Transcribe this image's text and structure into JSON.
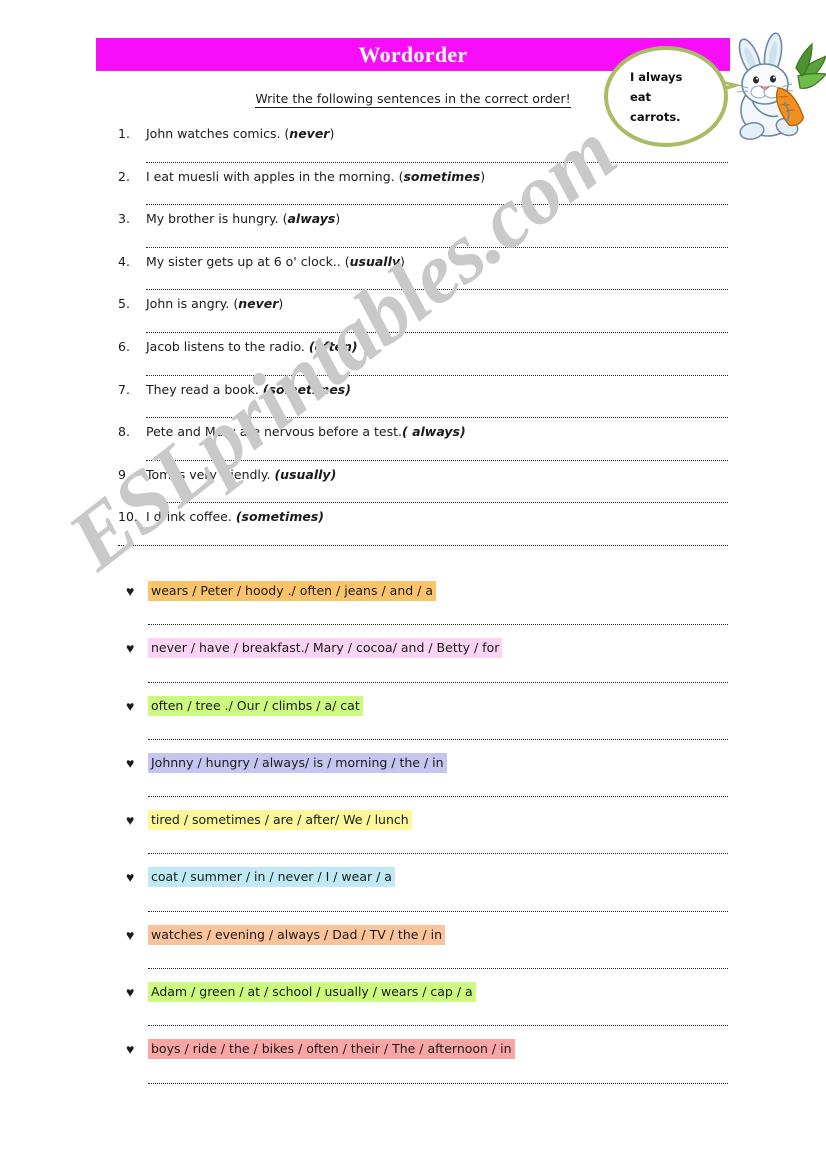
{
  "header": {
    "title": "Wordorder",
    "bar_color": "#f70df7",
    "title_color": "#ffffff"
  },
  "instruction": {
    "text": "Write the following sentences in the correct order!"
  },
  "speech_bubble": {
    "lines": [
      "I always",
      "eat",
      "carrots."
    ],
    "outline_color": "#a8bd63"
  },
  "rabbit": {
    "name": "rabbit-with-carrot-illustration"
  },
  "watermark": {
    "text": "ESLprintables.com",
    "color": "#c9c9c9"
  },
  "numbered_exercise": {
    "items": [
      {
        "number": "1.",
        "sentence": "John watches comics. (",
        "adverb": "never",
        "tail": ")"
      },
      {
        "number": "2.",
        "sentence": "I eat muesli with apples in the morning. (",
        "adverb": "sometimes",
        "tail": ")"
      },
      {
        "number": "3.",
        "sentence": "My brother is hungry. (",
        "adverb": "always",
        "tail": ")"
      },
      {
        "number": "4.",
        "sentence": "My sister gets up at 6 o' clock.. (",
        "adverb": "usually",
        "tail": ")"
      },
      {
        "number": "5.",
        "sentence": "John is angry. (",
        "adverb": "never",
        "tail": ")"
      },
      {
        "number": "6.",
        "sentence": "Jacob listens to the radio. ",
        "adverb": "(often)",
        "tail": ""
      },
      {
        "number": "7.",
        "sentence": "They read a book. ",
        "adverb": "(sometimes)",
        "tail": ""
      },
      {
        "number": "8.",
        "sentence": "Pete and Mary are nervous before a test.",
        "adverb": "( always)",
        "tail": ""
      },
      {
        "number": "9.",
        "sentence": "Tom is very friendly. ",
        "adverb": "(usually)",
        "tail": ""
      },
      {
        "number": "10.",
        "sentence": "I drink coffee. ",
        "adverb": "(sometimes)",
        "tail": ""
      }
    ]
  },
  "scrambled_exercise": {
    "bullet": "♥",
    "items": [
      {
        "text": "wears / Peter / hoody ./ often / jeans  / and / a",
        "highlight": "#fbc46a"
      },
      {
        "text": "never / have / breakfast./ Mary / cocoa/ and / Betty / for",
        "highlight": "#fbd4f5"
      },
      {
        "text": "often / tree ./ Our / climbs / a/ cat",
        "highlight": "#ccf97f"
      },
      {
        "text": "Johnny / hungry / always/ is / morning / the / in",
        "highlight": "#c5c5f0"
      },
      {
        "text": "tired / sometimes / are / after/ We / lunch",
        "highlight": "#fbf79a"
      },
      {
        "text": "coat / summer / in / never / I / wear / a",
        "highlight": "#bfeaf5"
      },
      {
        "text": "watches / evening / always / Dad / TV / the / in",
        "highlight": "#fbc39a"
      },
      {
        "text": "Adam /  green / at / school / usually / wears / cap / a",
        "highlight": "#ccf97f"
      },
      {
        "text": "boys / ride / the / bikes / often / their / The / afternoon / in",
        "highlight": "#f8a5a5"
      }
    ]
  }
}
